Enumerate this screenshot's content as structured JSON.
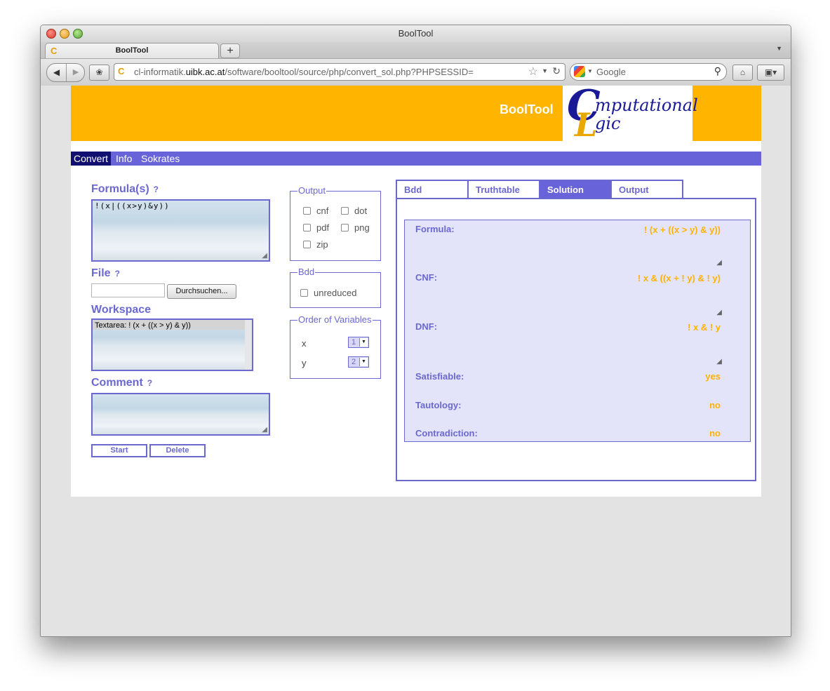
{
  "window": {
    "title": "BoolTool"
  },
  "tab": {
    "title": "BoolTool",
    "favicon": "C"
  },
  "browser": {
    "new_tab": "+",
    "back": "◀",
    "forward": "▶",
    "url_prefix": "cl-informatik.",
    "url_host": "uibk.ac.at",
    "url_path": "/software/booltool/source/php/convert_sol.php?PHPSESSID=",
    "search_placeholder": "Google"
  },
  "header": {
    "title": "BoolTool",
    "logo": {
      "c": "C",
      "l": "L",
      "word1": "mputational",
      "word2": "gic"
    }
  },
  "menu": {
    "items": [
      "Convert",
      "Info",
      "Sokrates"
    ]
  },
  "form": {
    "formula_label": "Formula(s)",
    "formula_value": "!(x|((x>y)&y))",
    "file_label": "File",
    "browse_label": "Durchsuchen...",
    "workspace_label": "Workspace",
    "workspace_item": "Textarea: ! (x + ((x > y) & y))",
    "comment_label": "Comment",
    "help": "?",
    "start_label": "Start",
    "delete_label": "Delete"
  },
  "output": {
    "legend": "Output",
    "options": [
      "cnf",
      "dot",
      "pdf",
      "png",
      "zip"
    ]
  },
  "bdd": {
    "legend": "Bdd",
    "option": "unreduced"
  },
  "order": {
    "legend": "Order of Variables",
    "vars": [
      {
        "name": "x",
        "value": "1"
      },
      {
        "name": "y",
        "value": "2"
      }
    ]
  },
  "tabs": {
    "items": [
      "Bdd",
      "Truthtable",
      "Solution",
      "Output"
    ],
    "active": "Solution"
  },
  "solution": {
    "formula_label": "Formula:",
    "formula_value": "! (x + ((x > y) & y))",
    "cnf_label": "CNF:",
    "cnf_value": "! x & ((x + ! y) & ! y)",
    "dnf_label": "DNF:",
    "dnf_value": "! x & ! y",
    "satisfiable_label": "Satisfiable:",
    "satisfiable_value": "yes",
    "tautology_label": "Tautology:",
    "tautology_value": "no",
    "contradiction_label": "Contradiction:",
    "contradiction_value": "no"
  },
  "colors": {
    "header": "#ffb500",
    "accent": "#6b68cf",
    "menu": "#6863d8",
    "menu_active": "#111070",
    "value": "#ffb300",
    "solution_bg": "#e3e3fa"
  }
}
